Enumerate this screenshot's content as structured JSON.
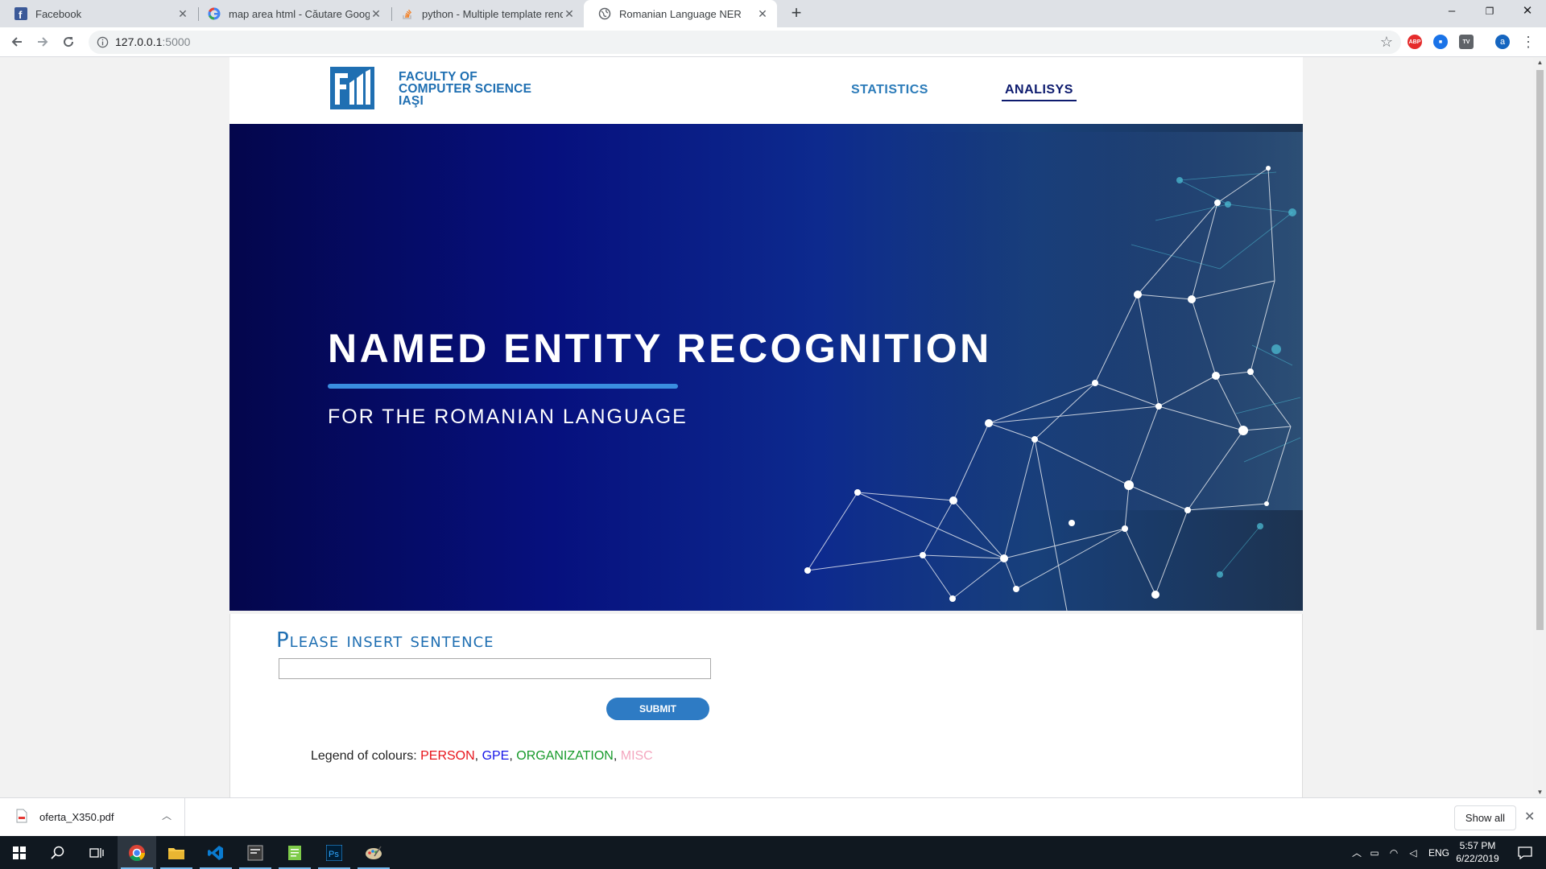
{
  "browser": {
    "tabs": [
      {
        "label": "Facebook",
        "icon": "facebook-icon"
      },
      {
        "label": "map area html - Căutare Google",
        "icon": "google-icon"
      },
      {
        "label": "python - Multiple template rende",
        "icon": "stackoverflow-icon"
      },
      {
        "label": "Romanian Language NER",
        "icon": "globe-icon",
        "active": true
      }
    ],
    "url_host": "127.0.0.1",
    "url_port": ":5000",
    "extensions": [
      {
        "name": "adblock-icon",
        "text": "ABP",
        "color": "#e52c2c"
      },
      {
        "name": "extension-blue-icon",
        "text": "",
        "color": "#1a73e8"
      },
      {
        "name": "extension-tv-icon",
        "text": "TV",
        "color": "#5f6368"
      },
      {
        "name": "profile-avatar",
        "text": "a",
        "color": "#1565c0"
      }
    ]
  },
  "site": {
    "logo_text_lines": [
      "FACULTY OF",
      "COMPUTER SCIENCE",
      "IAŞI"
    ],
    "nav": {
      "statistics": "STATISTICS",
      "analisys": "ANALISYS"
    },
    "hero": {
      "title": "NAMED ENTITY RECOGNITION",
      "subtitle": "FOR THE ROMANIAN LANGUAGE"
    },
    "form": {
      "title": "Please insert sentence",
      "input_value": "",
      "submit_label": "SUBMIT",
      "legend_prefix": "Legend of colours: ",
      "legend": {
        "person": "PERSON",
        "gpe": "GPE",
        "organization": "ORGANIZATION",
        "misc": "MISC",
        "sep": ", "
      }
    },
    "colors": {
      "brand_blue": "#1f6fb2",
      "person": "#e8141b",
      "gpe": "#1515e8",
      "organization": "#169a2a",
      "misc": "#f4a7bf"
    }
  },
  "downloads": {
    "file_name": "oferta_X350.pdf",
    "show_all": "Show all"
  },
  "taskbar": {
    "apps": [
      "windows-start-icon",
      "search-icon",
      "task-view-icon",
      "chrome-icon",
      "file-explorer-icon",
      "vscode-icon",
      "app-icon",
      "notepad-icon",
      "photoshop-icon",
      "paint-icon"
    ],
    "language": "ENG",
    "time": "5:57 PM",
    "date": "6/22/2019"
  }
}
